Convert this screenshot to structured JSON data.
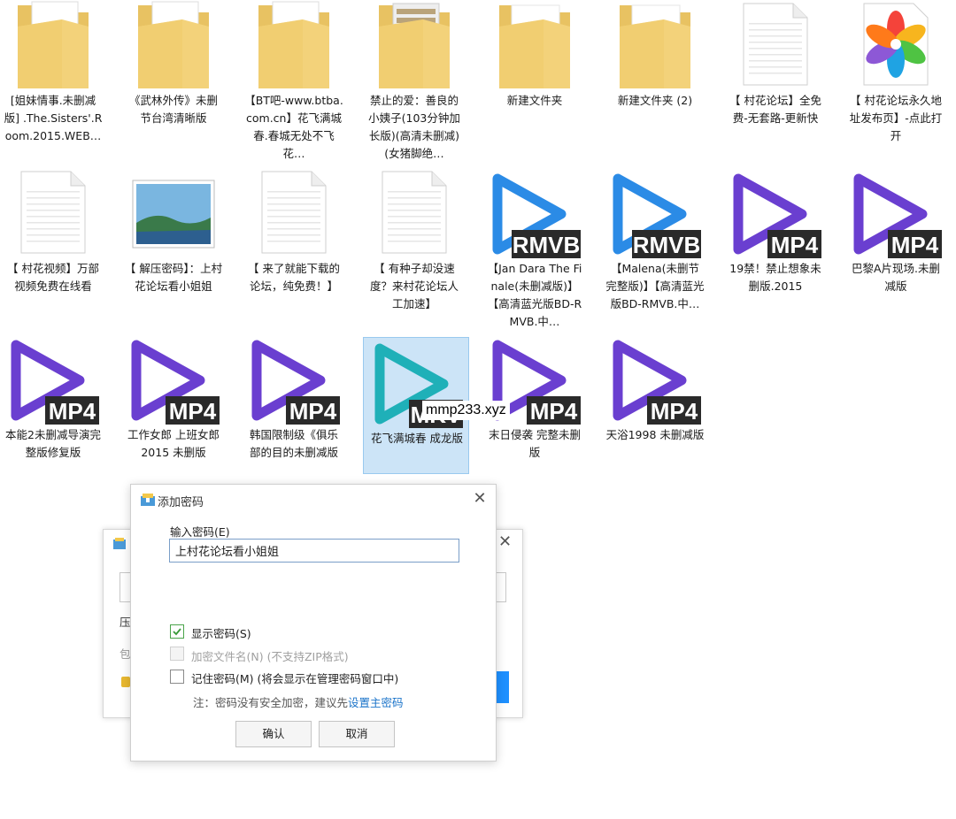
{
  "files": [
    {
      "type": "folder-doc",
      "label": "[姐妹情事.未删减版] .The.Sisters'.Room.2015.WEB…"
    },
    {
      "type": "folder-doc",
      "label": "《武林外传》未删节台湾清晰版"
    },
    {
      "type": "folder-doc",
      "label": "【BT吧-www.btba.com.cn】花飞满城春.春城无处不飞花…"
    },
    {
      "type": "folder-film",
      "label": "禁止的爱：善良的小姨子(103分钟加长版)(高清未删减)(女猪脚绝…"
    },
    {
      "type": "folder",
      "label": "新建文件夹"
    },
    {
      "type": "folder",
      "label": "新建文件夹 (2)"
    },
    {
      "type": "doc",
      "label": "【 村花论坛】全免费-无套路-更新快"
    },
    {
      "type": "colorful",
      "label": "【 村花论坛永久地址发布页】-点此打开"
    },
    {
      "type": "doc",
      "label": "【 村花视频】万部视频免费在线看"
    },
    {
      "type": "image",
      "label": "【 解压密码】：上村花论坛看小姐姐"
    },
    {
      "type": "doc",
      "label": "【 来了就能下载的论坛，纯免费！】"
    },
    {
      "type": "doc",
      "label": "【 有种子却没速度？来村花论坛人工加速】"
    },
    {
      "type": "video",
      "badge": "RMVB",
      "color": "#2b8be6",
      "label": "【Jan Dara The Finale(未删减版)】【高清蓝光版BD-RMVB.中…"
    },
    {
      "type": "video",
      "badge": "RMVB",
      "color": "#2b8be6",
      "label": "【Malena(未删节完整版)】【高清蓝光版BD-RMVB.中…"
    },
    {
      "type": "video",
      "badge": "MP4",
      "color": "#6a3fd0",
      "label": "19禁！禁止想象未删版.2015"
    },
    {
      "type": "video",
      "badge": "MP4",
      "color": "#6a3fd0",
      "label": "巴黎A片现场.未删减版"
    },
    {
      "type": "video",
      "badge": "MP4",
      "color": "#6a3fd0",
      "label": "本能2未删减导演完整版修复版"
    },
    {
      "type": "video",
      "badge": "MP4",
      "color": "#6a3fd0",
      "label": "工作女郎 上班女郎 2015 未删版"
    },
    {
      "type": "video",
      "badge": "MP4",
      "color": "#6a3fd0",
      "label": "韩国限制级《俱乐部的目的未删减版"
    },
    {
      "type": "video",
      "badge": "MKV",
      "color": "#1fb0b8",
      "label": "花飞满城春 成龙版",
      "selected": true
    },
    {
      "type": "video",
      "badge": "MP4",
      "color": "#6a3fd0",
      "label": "末日侵袭 完整未删版"
    },
    {
      "type": "video",
      "badge": "MP4",
      "color": "#6a3fd0",
      "label": "天浴1998 未删减版"
    }
  ],
  "watermark": "mmp233.xyz",
  "back_dialog": {
    "text1": "压",
    "text2": "包"
  },
  "dialog": {
    "title": "添加密码",
    "close": "✕",
    "password_label": "输入密码(E)",
    "password_value": "上村花论坛看小姐姐",
    "show_password": "显示密码(S)",
    "encrypt_filenames": "加密文件名(N) (不支持ZIP格式)",
    "remember_password": "记住密码(M) (将会显示在管理密码窗口中)",
    "note_prefix": "注：密码没有安全加密，建议先",
    "note_link": "设置主密码",
    "ok": "确认",
    "cancel": "取消"
  }
}
